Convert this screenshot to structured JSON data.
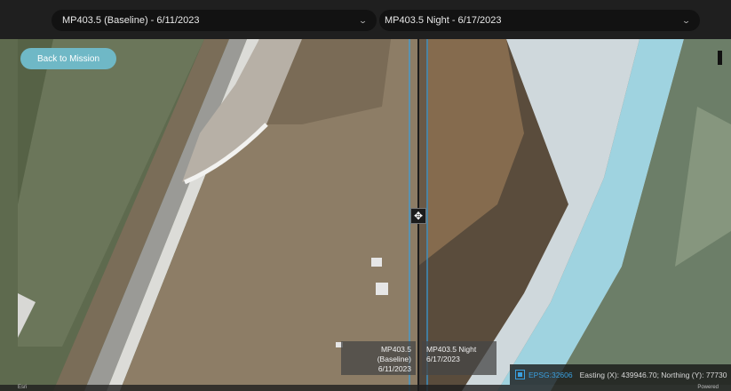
{
  "comparison": {
    "left_select": {
      "value": "MP403.5 (Baseline) - 6/11/2023",
      "chevron_icon": "chevron-down-icon"
    },
    "right_select": {
      "value": "MP403.5 Night - 6/17/2023",
      "chevron_icon": "chevron-down-icon"
    }
  },
  "map": {
    "back_button": "Back to Mission",
    "divider_icon": "move-arrows-icon",
    "left_label": {
      "line1": "MP403.5 (Baseline)",
      "line2": "6/11/2023"
    },
    "right_label": {
      "line1": "MP403.5 Night",
      "line2": "6/17/2023"
    },
    "coordinates": {
      "epsg": "EPSG:32606",
      "text": "Easting (X): 439946.70; Northing (Y): 77730"
    },
    "attribution_left": "Esri",
    "attribution_right": "Powered",
    "accent_color": "#3aa0e0",
    "button_color": "#6fb8c6"
  }
}
